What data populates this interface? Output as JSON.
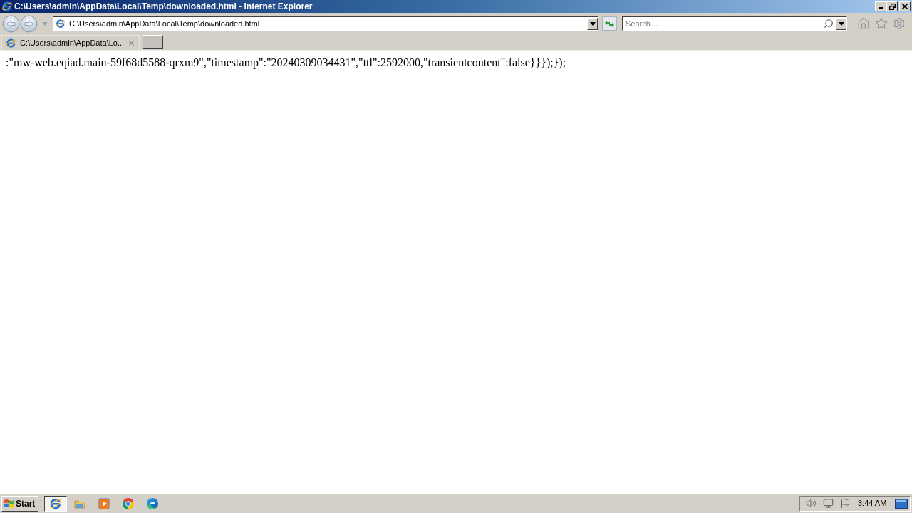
{
  "window": {
    "title": "C:\\Users\\admin\\AppData\\Local\\Temp\\downloaded.html - Internet Explorer"
  },
  "address_bar": {
    "value": "C:\\Users\\admin\\AppData\\Local\\Temp\\downloaded.html"
  },
  "search": {
    "placeholder": "Search…"
  },
  "tabs": [
    {
      "label": "C:\\Users\\admin\\AppData\\Lo...",
      "selected": true
    }
  ],
  "page": {
    "text": ":\"mw-web.eqiad.main-59f68d5588-qrxm9\",\"timestamp\":\"20240309034431\",\"ttl\":2592000,\"transientcontent\":false}}});});"
  },
  "taskbar": {
    "start_label": "Start",
    "apps": [
      {
        "kind": "ie",
        "selected": true
      },
      {
        "kind": "explorer",
        "selected": false
      },
      {
        "kind": "media",
        "selected": false
      },
      {
        "kind": "chrome",
        "selected": false
      },
      {
        "kind": "edge",
        "selected": false
      }
    ],
    "clock": "3:44 AM"
  }
}
